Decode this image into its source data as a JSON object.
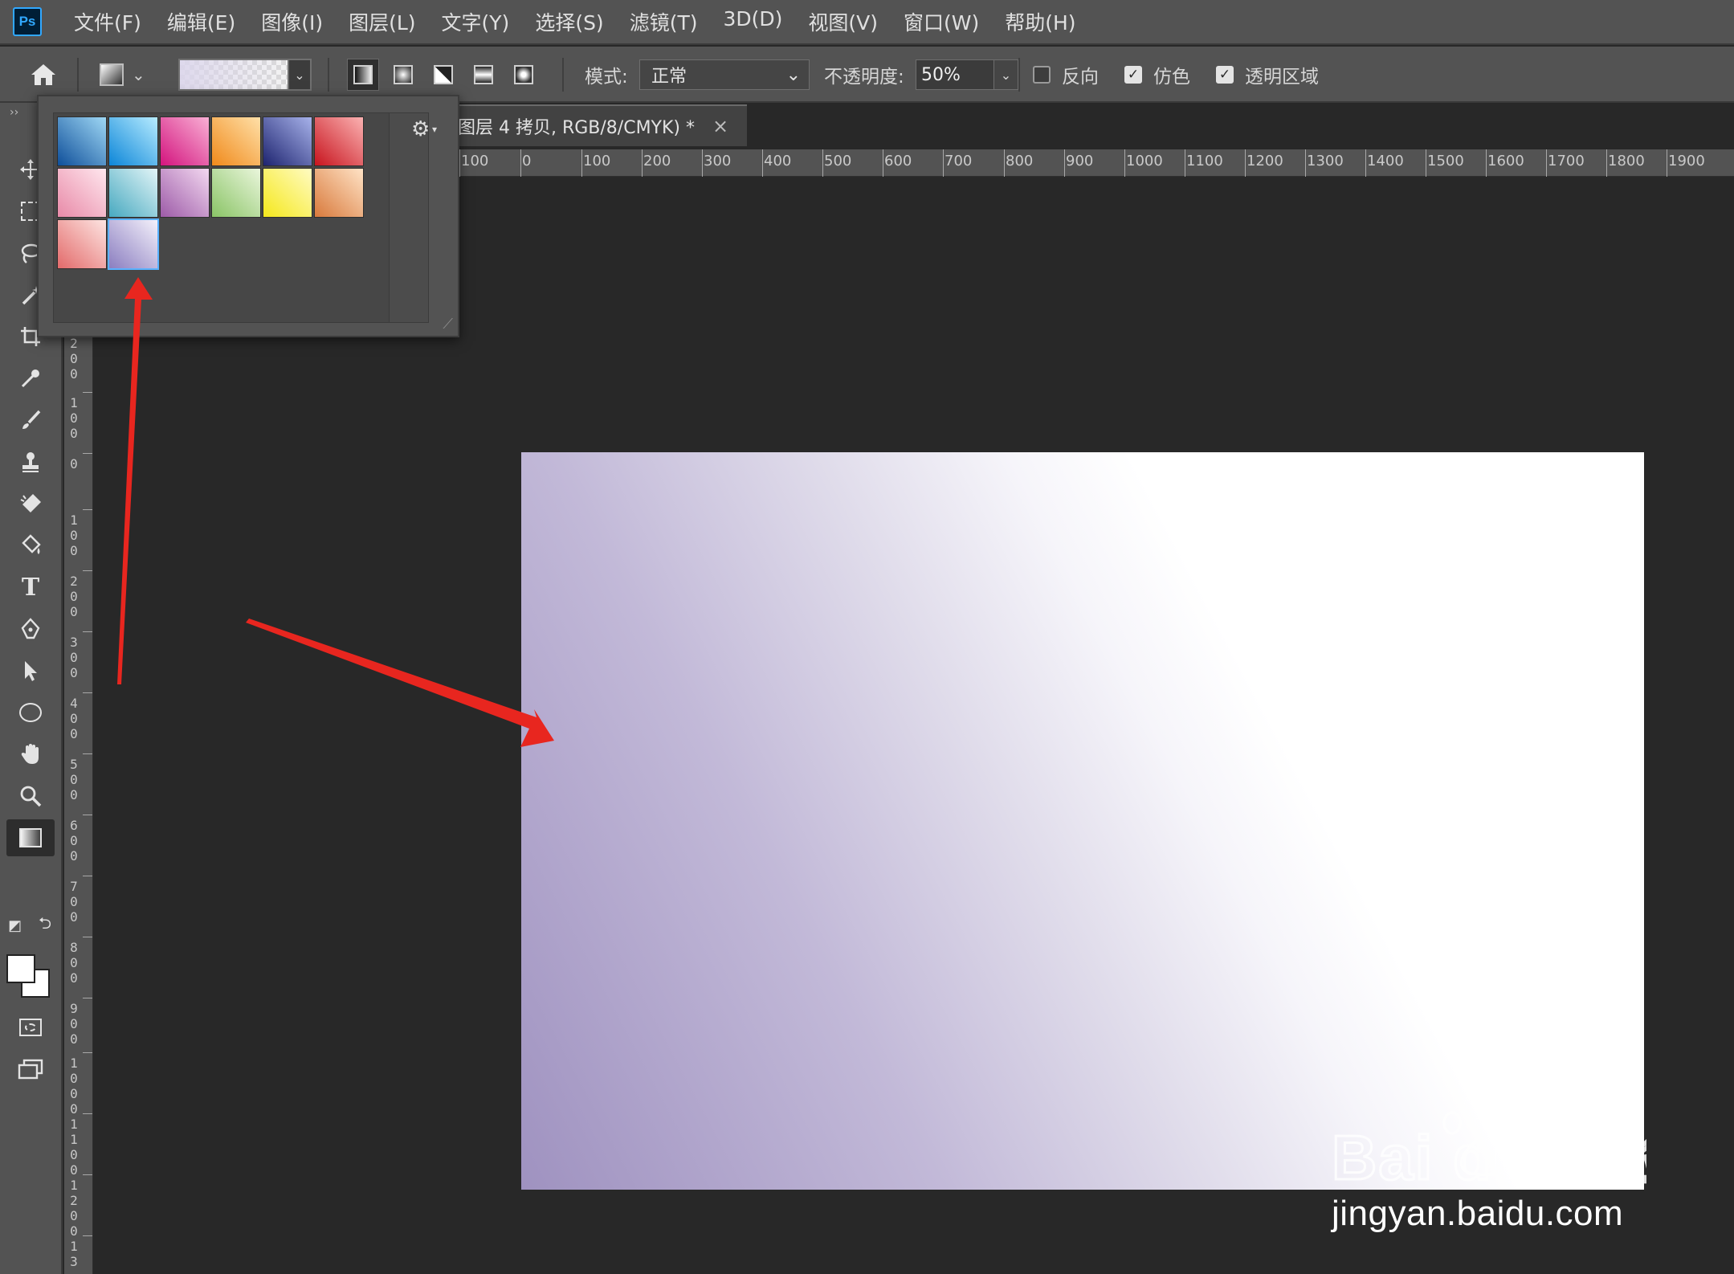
{
  "app": {
    "logo_text": "Ps"
  },
  "menu": [
    "文件(F)",
    "编辑(E)",
    "图像(I)",
    "图层(L)",
    "文字(Y)",
    "选择(S)",
    "滤镜(T)",
    "3D(D)",
    "视图(V)",
    "窗口(W)",
    "帮助(H)"
  ],
  "options": {
    "mode_label": "模式:",
    "mode_value": "正常",
    "opacity_label": "不透明度:",
    "opacity_value": "50%",
    "reverse_label": "反向",
    "reverse_checked": false,
    "dither_label": "仿色",
    "dither_checked": true,
    "transparency_label": "透明区域",
    "transparency_checked": true
  },
  "document": {
    "tab_title": "图层 4 拷贝, RGB/8/CMYK) *",
    "close_glyph": "×"
  },
  "ruler_h": [
    "100",
    "0",
    "100",
    "200",
    "300",
    "400",
    "500",
    "600",
    "700",
    "800",
    "900",
    "1000",
    "1100",
    "1200",
    "1300",
    "1400",
    "1500",
    "1600",
    "1700",
    "1800",
    "1900"
  ],
  "ruler_v": [
    "200",
    "100",
    "0",
    "100",
    "200",
    "300",
    "400",
    "500",
    "600",
    "700",
    "800",
    "900",
    "1000",
    "1100",
    "1200",
    "13"
  ],
  "gradient_presets": [
    {
      "name": "blue",
      "colors": [
        "#0f4f9a",
        "#9fd8f5"
      ]
    },
    {
      "name": "cyan",
      "colors": [
        "#0c86d8",
        "#b7ecff"
      ]
    },
    {
      "name": "magenta",
      "colors": [
        "#d3147e",
        "#f9b0d5"
      ]
    },
    {
      "name": "orange",
      "colors": [
        "#f08a1b",
        "#ffe0a8"
      ]
    },
    {
      "name": "navy",
      "colors": [
        "#1e2470",
        "#a7b2ea"
      ]
    },
    {
      "name": "red",
      "colors": [
        "#c8141e",
        "#fbb2b2"
      ]
    },
    {
      "name": "pink",
      "colors": [
        "#e88aa8",
        "#ffe7ee"
      ]
    },
    {
      "name": "teal",
      "colors": [
        "#47a9c0",
        "#e3f5f7"
      ]
    },
    {
      "name": "purple",
      "colors": [
        "#9d5ba8",
        "#f3d8f0"
      ]
    },
    {
      "name": "green",
      "colors": [
        "#8ac466",
        "#eaf6dc"
      ]
    },
    {
      "name": "yellow",
      "colors": [
        "#f5e81c",
        "#fffbc2"
      ]
    },
    {
      "name": "copper",
      "colors": [
        "#d97a3c",
        "#ffe3c6"
      ]
    },
    {
      "name": "coral",
      "colors": [
        "#e36a6a",
        "#fde5e2"
      ]
    },
    {
      "name": "lavender",
      "colors": [
        "#8b7ec0",
        "#f4f1fb"
      ],
      "selected": true
    }
  ],
  "canvas": {
    "gradient_start": "#9f92c0",
    "gradient_end": "#ffffff"
  },
  "colors": {
    "annotation_arrow": "#e8261f",
    "selection_outline": "#5ab2ff"
  },
  "watermark": {
    "logo_text": "Bai du 经验",
    "url": "jingyan.baidu.com"
  }
}
